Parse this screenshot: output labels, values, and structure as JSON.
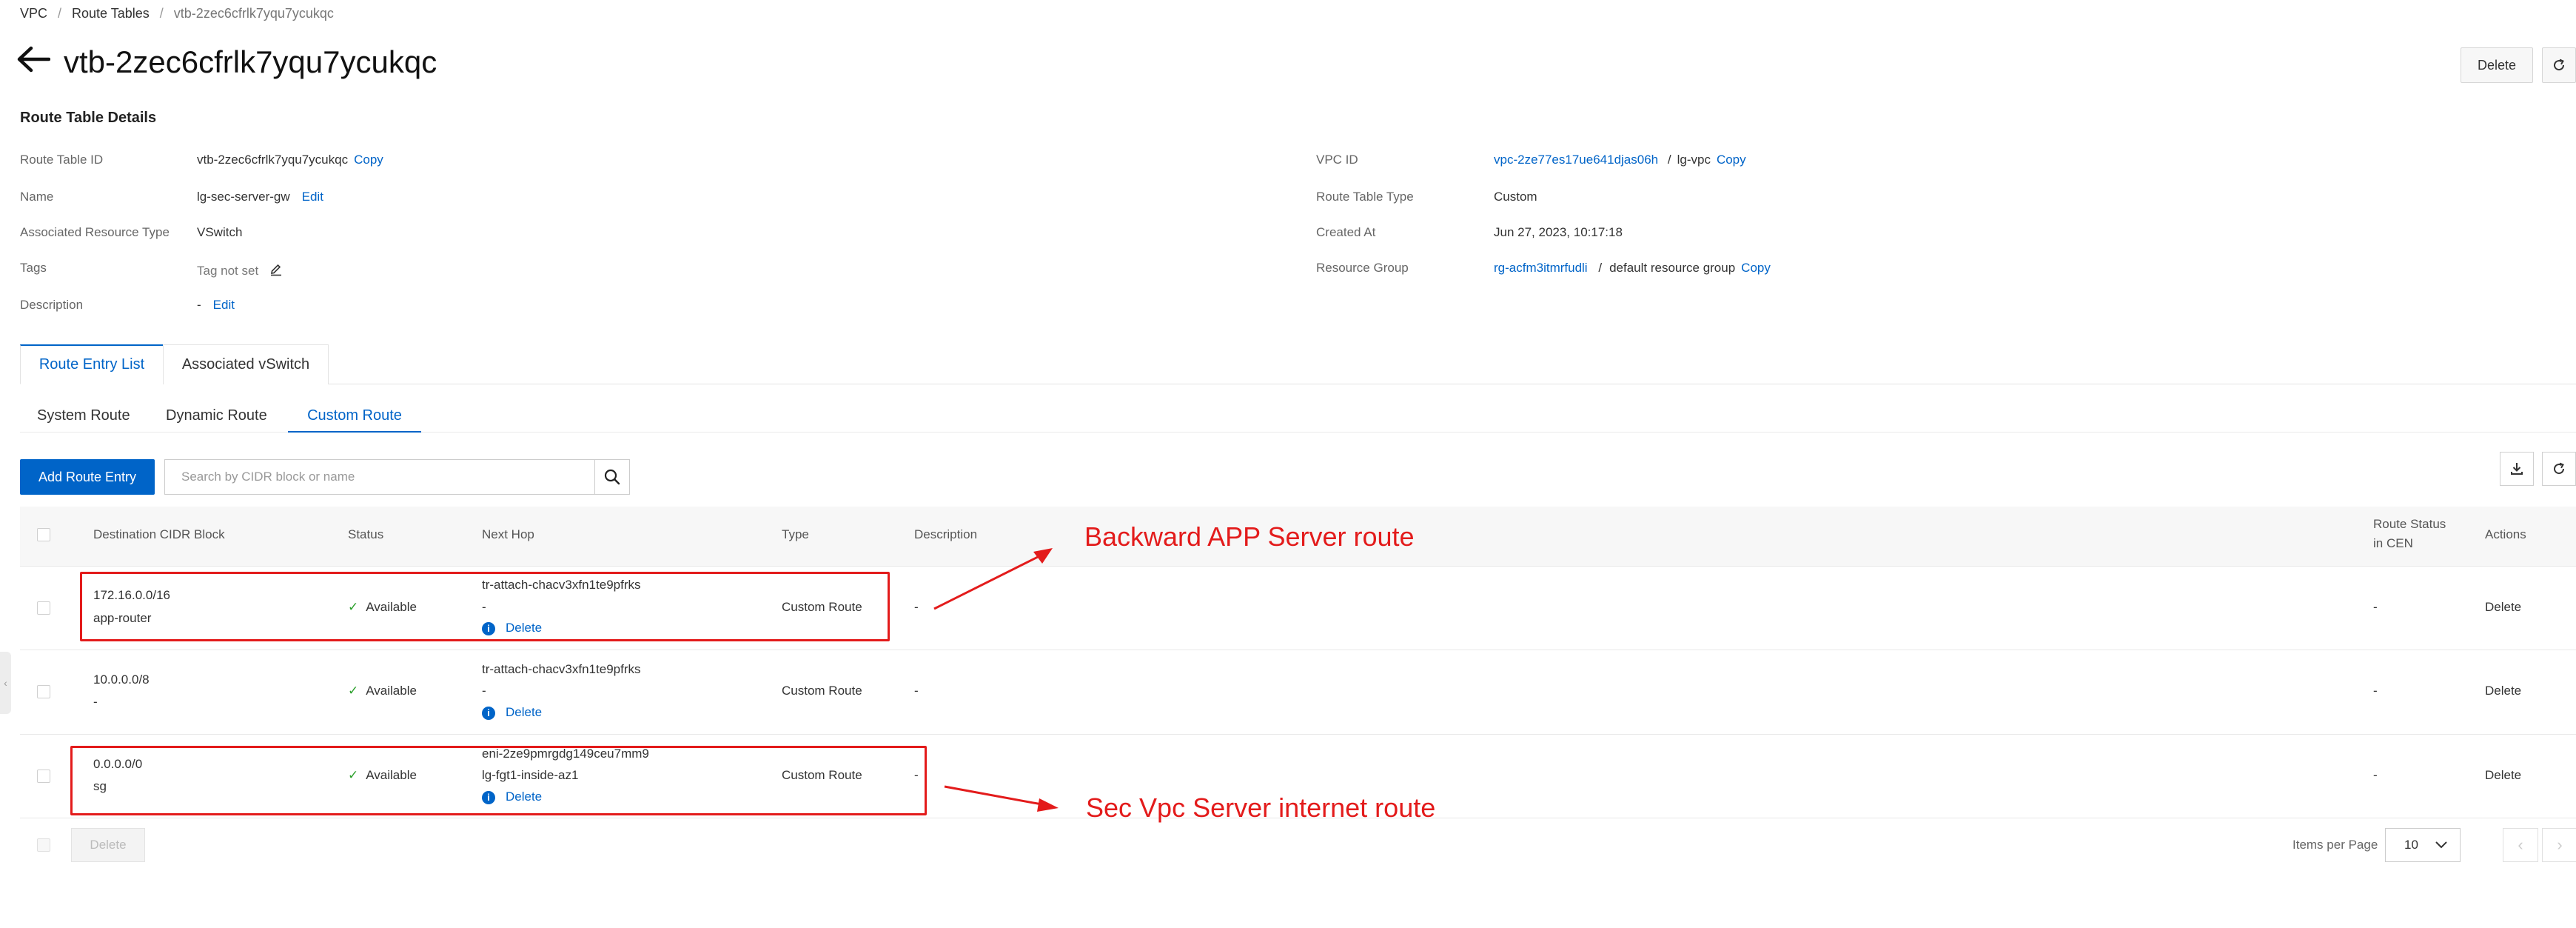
{
  "breadcrumb": {
    "items": [
      "VPC",
      "Route Tables"
    ],
    "current": "vtb-2zec6cfrlk7yqu7ycukqc",
    "separator": "/"
  },
  "header": {
    "title": "vtb-2zec6cfrlk7yqu7ycukqc",
    "delete_label": "Delete"
  },
  "details": {
    "section_title": "Route Table Details",
    "left": {
      "route_table_id_label": "Route Table ID",
      "route_table_id": "vtb-2zec6cfrlk7yqu7ycukqc",
      "name_label": "Name",
      "name": "lg-sec-server-gw",
      "assoc_type_label": "Associated Resource Type",
      "assoc_type": "VSwitch",
      "tags_label": "Tags",
      "tags": "Tag not set",
      "description_label": "Description",
      "description": "-"
    },
    "right": {
      "vpc_id_label": "VPC ID",
      "vpc_id": "vpc-2ze77es17ue641djas06h",
      "vpc_name": "lg-vpc",
      "vpc_sep": "/",
      "type_label": "Route Table Type",
      "type": "Custom",
      "created_label": "Created At",
      "created": "Jun 27, 2023, 10:17:18",
      "rg_label": "Resource Group",
      "rg_id": "rg-acfm3itmrfudli",
      "rg_sep": "/",
      "rg_name": "default resource group"
    },
    "copy_label": "Copy",
    "edit_label": "Edit"
  },
  "tabs": [
    "Route Entry List",
    "Associated vSwitch"
  ],
  "subtabs": [
    "System Route",
    "Dynamic Route",
    "Custom Route"
  ],
  "toolbar": {
    "add_label": "Add Route Entry",
    "search_placeholder": "Search by CIDR block or name"
  },
  "table": {
    "headers": {
      "dest": "Destination CIDR Block",
      "status": "Status",
      "next_hop": "Next Hop",
      "type": "Type",
      "description": "Description",
      "cen_line1": "Route Status",
      "cen_line2": "in CEN",
      "actions": "Actions"
    },
    "rows": [
      {
        "cidr": "172.16.0.0/16",
        "name": "app-router",
        "status": "Available",
        "hop1": "tr-attach-chacv3xfn1te9pfrks",
        "hop2": "-",
        "hop_action": "Delete",
        "type": "Custom Route",
        "description": "-",
        "cen": "-",
        "action": "Delete"
      },
      {
        "cidr": "10.0.0.0/8",
        "name": "-",
        "status": "Available",
        "hop1": "tr-attach-chacv3xfn1te9pfrks",
        "hop2": "-",
        "hop_action": "Delete",
        "type": "Custom Route",
        "description": "-",
        "cen": "-",
        "action": "Delete"
      },
      {
        "cidr": "0.0.0.0/0",
        "name": "sg",
        "status": "Available",
        "hop1": "eni-2ze9pmrgdg149ceu7mm9",
        "hop2": "lg-fgt1-inside-az1",
        "hop_action": "Delete",
        "type": "Custom Route",
        "description": "-",
        "cen": "-",
        "action": "Delete"
      }
    ]
  },
  "footer": {
    "delete_label": "Delete",
    "items_per_page_label": "Items per Page",
    "page_size": "10"
  },
  "annotations": {
    "label1": "Backward APP Server route",
    "label2": "Sec Vpc Server internet route",
    "color": "#e31b1b"
  },
  "colors": {
    "accent": "#0064c8",
    "success": "#2ca02c"
  }
}
